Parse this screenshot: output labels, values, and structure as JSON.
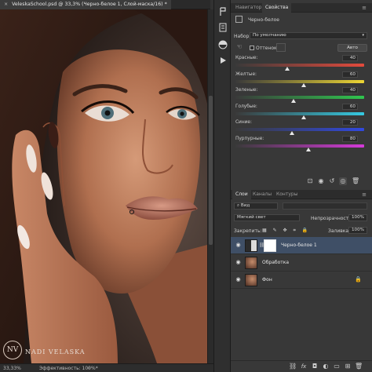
{
  "document": {
    "tab_title": "VeleskaSchool.psd @ 33,3% (Черно-белое 1, Слой-маска/16) *",
    "close_glyph": "×"
  },
  "status_bar": {
    "zoom": "33,33%",
    "info": "Эффективность: 100%*",
    "arrow": "›"
  },
  "watermark": {
    "monogram": "NV",
    "name": "NADI VELASKA"
  },
  "tools": [
    "history-brush-icon",
    "info-icon",
    "adjustments-icon",
    "layers-icon",
    "properties-icon",
    "play-icon"
  ],
  "properties_panel": {
    "tabs": [
      {
        "label": "Навигатор",
        "active": false
      },
      {
        "label": "Свойства",
        "active": true
      }
    ],
    "menu_glyph": "≡",
    "adjustment_title": "Черно-белое",
    "preset_label": "Набор:",
    "preset_value": "По умолчанию",
    "tint_label": "Оттенок",
    "auto_label": "Авто",
    "sliders": [
      {
        "label": "Красные:",
        "value": "40",
        "fraction": 0.4
      },
      {
        "label": "Желтые:",
        "value": "60",
        "fraction": 0.53
      },
      {
        "label": "Зеленые:",
        "value": "40",
        "fraction": 0.45
      },
      {
        "label": "Голубые:",
        "value": "60",
        "fraction": 0.53
      },
      {
        "label": "Синие:",
        "value": "20",
        "fraction": 0.44
      },
      {
        "label": "Пурпурные:",
        "value": "80",
        "fraction": 0.57
      }
    ],
    "colors": {
      "red_track": [
        "#3a3a3a",
        "#e34a3c"
      ],
      "yellow_track": [
        "#3a3a3a",
        "#ecd534"
      ],
      "green_track": [
        "#3a3a3a",
        "#2fc54e"
      ],
      "cyan_track": [
        "#3a3a3a",
        "#35c9e1"
      ],
      "blue_track": [
        "#3a3a3a",
        "#3149de"
      ],
      "magenta_track": [
        "#3a3a3a",
        "#d53ad9"
      ]
    },
    "footer_icons": [
      "clip-icon",
      "view-previous-icon",
      "reset-icon",
      "visibility-icon",
      "trash-icon"
    ]
  },
  "layers_panel": {
    "tabs": [
      {
        "label": "Слои",
        "active": true
      },
      {
        "label": "Каналы",
        "active": false
      },
      {
        "label": "Контуры",
        "active": false
      }
    ],
    "menu_glyph": "≡",
    "filter_label": "Вид",
    "blend_mode": "Мягкий свет",
    "opacity_label": "Непрозрачность:",
    "opacity_value": "100%",
    "lock_label": "Закрепить:",
    "fill_label": "Заливка:",
    "fill_value": "100%",
    "layers": [
      {
        "name": "Черно-белое 1",
        "selected": true,
        "type": "adjustment"
      },
      {
        "name": "Обработка",
        "selected": false,
        "type": "image"
      },
      {
        "name": "Фон",
        "selected": false,
        "type": "image",
        "locked": true
      }
    ],
    "footer_icons": [
      "link-icon",
      "fx-icon",
      "mask-icon",
      "adjustment-layer-icon",
      "group-icon",
      "new-layer-icon",
      "trash-icon"
    ],
    "fx_label": "fx"
  }
}
